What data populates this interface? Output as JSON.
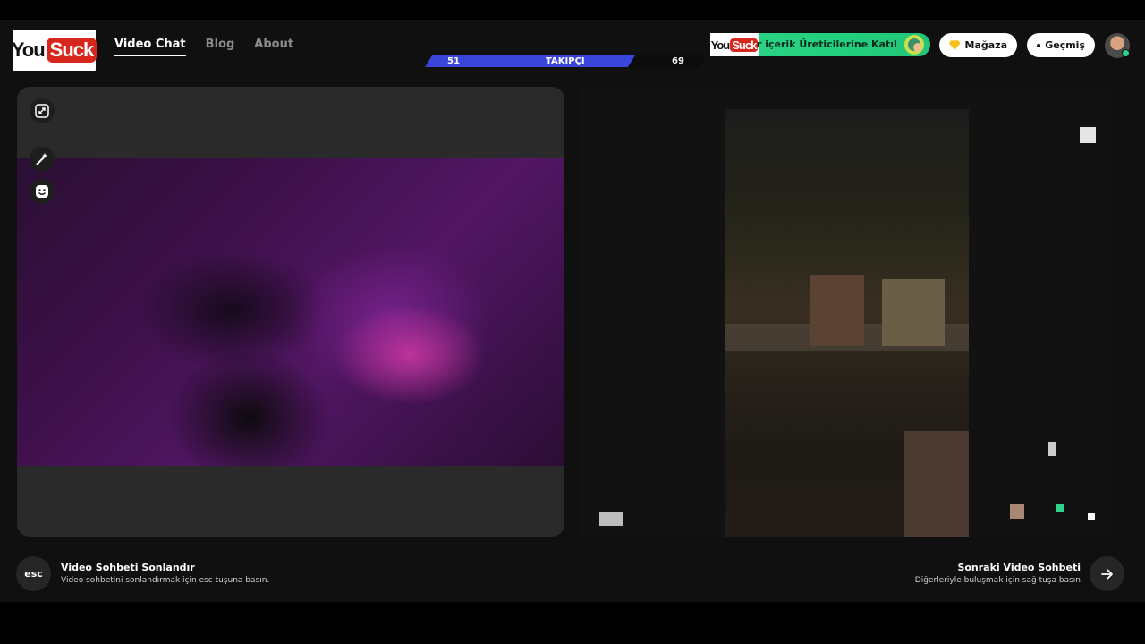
{
  "brand": {
    "logo_you": "You",
    "logo_suck": "Suck"
  },
  "nav": [
    {
      "label": "Video Chat",
      "active": true
    },
    {
      "label": "Blog",
      "active": false
    },
    {
      "label": "About",
      "active": false
    }
  ],
  "follow_bar": {
    "left_count": "51",
    "label": "TAKIPÇI",
    "right_count": "69",
    "color": "#3a46d9"
  },
  "promo": {
    "logo_you": "You",
    "logo_suck": "Suck",
    "text": "r içerik Üreticilerine Katıl",
    "color": "#2fd38a"
  },
  "header_buttons": {
    "store": "Mağaza",
    "history": "Geçmiş"
  },
  "icons": {
    "expand": "expand-icon",
    "magic": "magic-wand-icon",
    "face": "face-icon",
    "diamond": "diamond-icon",
    "clock": "clock-icon",
    "arrow": "arrow-right-icon"
  },
  "bottom": {
    "left_key": "esc",
    "left_title": "Video Sohbeti Sonlandır",
    "left_sub": "Video sohbetini sonlandırmak için esc tuşuna basın.",
    "right_title": "Sonraki Video Sohbeti",
    "right_sub": "Diğerleriyle buluşmak için sağ tuşa basın"
  }
}
